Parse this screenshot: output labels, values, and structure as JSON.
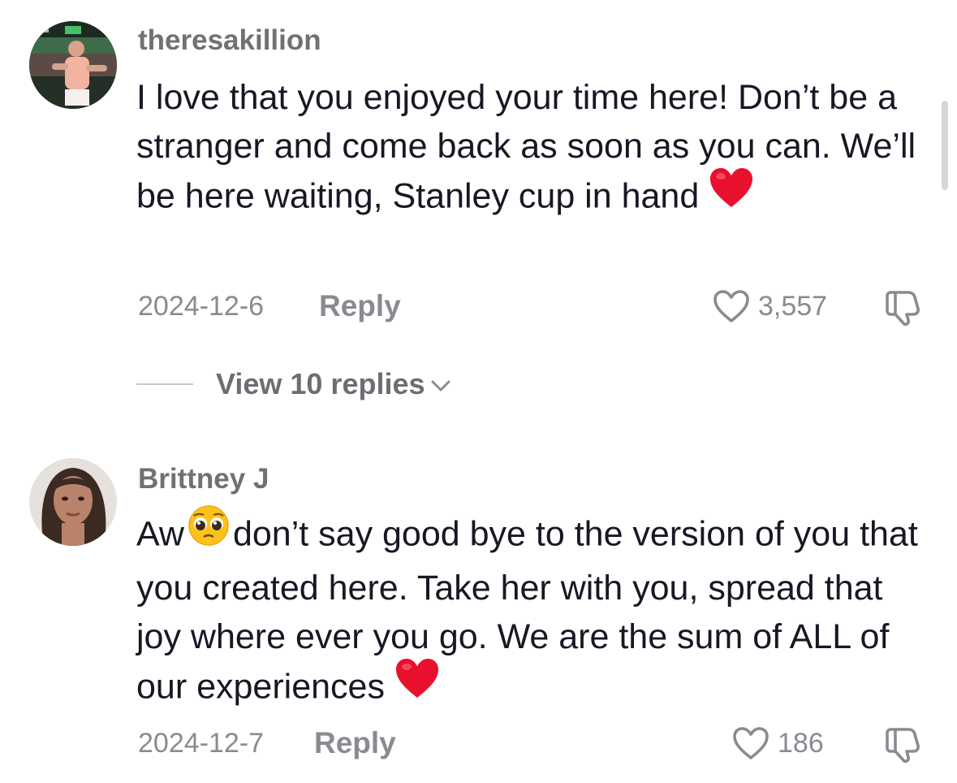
{
  "comments": [
    {
      "username": "theresakillion",
      "text": "I love that you enjoyed your time here! Don’t be a stranger and come back as soon as you can. We’ll be here waiting, Stanley cup in hand",
      "date": "2024-12-6",
      "reply_label": "Reply",
      "likes": "3,557",
      "view_replies_label": "View 10 replies"
    },
    {
      "username": "Brittney J",
      "text_before_emoji": "Aw",
      "text_after_emoji": "don’t say good bye to the version of you that you created here. Take her with you, spread that joy where ever you go. We are the sum of ALL of our experiences",
      "date": "2024-12-7",
      "reply_label": "Reply",
      "likes": "186"
    }
  ],
  "icons": {
    "like": "heart-outline-icon",
    "dislike": "thumbs-down-icon",
    "heart_emoji": "red-heart-emoji",
    "pleading_emoji": "pleading-face-emoji",
    "expand": "chevron-down-icon"
  },
  "colors": {
    "text": "#161823",
    "secondary": "#8a8b91",
    "username": "#717171",
    "heart": "#e8112d"
  }
}
